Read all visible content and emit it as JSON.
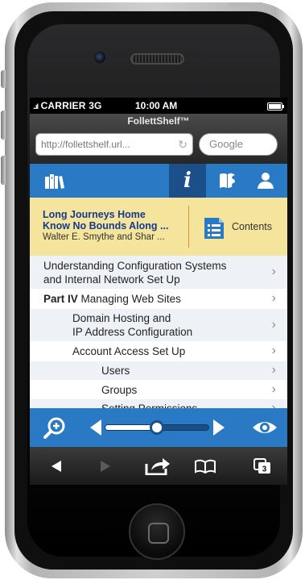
{
  "status": {
    "carrier": "CARRIER",
    "network": "3G",
    "time": "10:00 AM"
  },
  "browser": {
    "app_title": "FollettShelf™",
    "url": "http://follettshelf.url...",
    "search_placeholder": "Google"
  },
  "app_nav": {
    "items": [
      {
        "icon": "bookshelf-icon"
      },
      {
        "icon": "info-icon",
        "active": true
      },
      {
        "icon": "notes-icon"
      },
      {
        "icon": "user-icon"
      }
    ]
  },
  "book": {
    "title_line1": "Long Journeys Home",
    "title_line2": "Know No Bounds Along ...",
    "authors": "Walter E. Smythe and Shar ...",
    "contents_label": "Contents"
  },
  "toc": {
    "items": [
      {
        "label": "Understanding Configuration Systems",
        "label2": "and Internal Network Set Up",
        "level": 0
      },
      {
        "prefix": "Part IV",
        "label": " Managing Web Sites",
        "level": 0
      },
      {
        "label": "Domain Hosting and",
        "label2": "IP Address Configuration",
        "level": 1
      },
      {
        "label": "Account Access Set Up",
        "level": 1
      },
      {
        "label": "Users",
        "level": 2
      },
      {
        "label": "Groups",
        "level": 2
      },
      {
        "label": "Setting Permissions",
        "level": 2
      }
    ]
  },
  "reader": {
    "progress": 0.5
  },
  "colors": {
    "accent_blue": "#2a79c4",
    "active_tab": "#1b4f8a",
    "book_banner": "#f5e49c",
    "title_text": "#123a8f"
  },
  "safari_toolbar": {
    "tabs_count": "3"
  }
}
